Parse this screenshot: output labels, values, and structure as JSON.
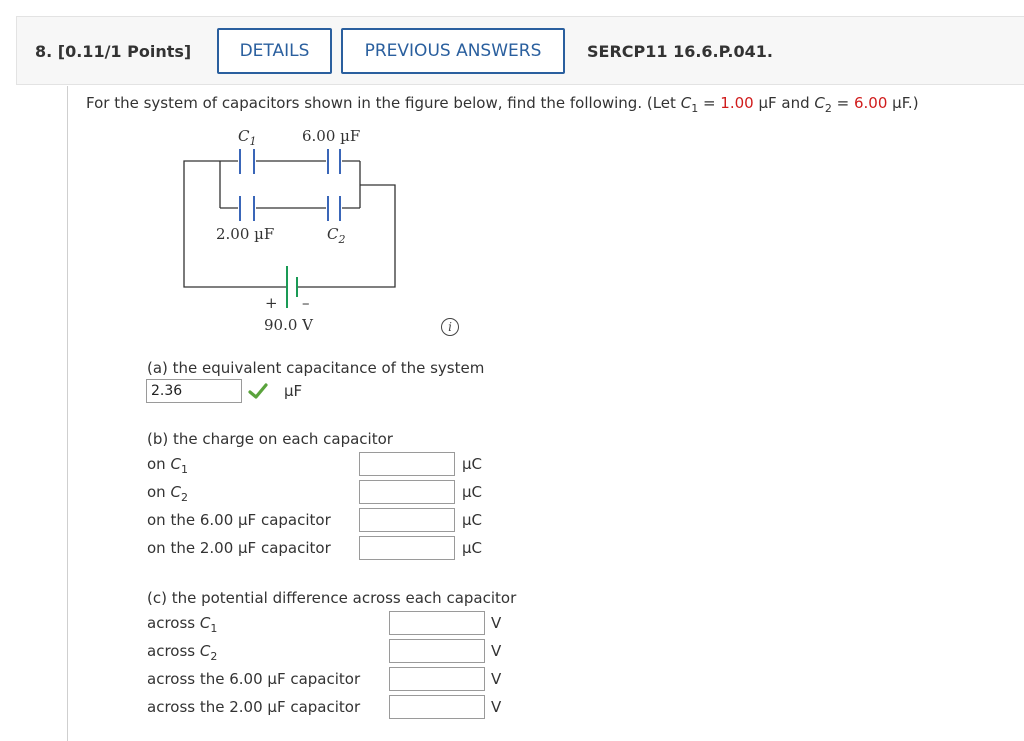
{
  "header": {
    "question_number": "8. [0.11/1 Points]",
    "details_label": "DETAILS",
    "previous_answers_label": "PREVIOUS ANSWERS",
    "problem_code": "SERCP11 16.6.P.041."
  },
  "prompt": {
    "intro": "For the system of capacitors shown in the figure below, find the following. (Let ",
    "c1_symbol": "C",
    "c1_sub": "1",
    "eq1": " = ",
    "c1_value": "1.00",
    "c1_unit_and": " µF and ",
    "c2_symbol": "C",
    "c2_sub": "2",
    "eq2": " = ",
    "c2_value": "6.00",
    "c2_unit_close": " µF.)",
    "highlight_color": "#d01c1c"
  },
  "figure": {
    "label_c1": "C",
    "label_c1_sub": "1",
    "label_6uf": "6.00 µF",
    "label_2uf": "2.00 µF",
    "label_c2": "C",
    "label_c2_sub": "2",
    "plus": "+",
    "minus": "–",
    "battery_voltage": "90.0 V",
    "battery_color": "#1a9a55",
    "capacitor_color": "#3a66b8"
  },
  "part_a": {
    "title": "(a) the equivalent capacitance of the system",
    "value": "2.36",
    "unit": "µF",
    "status": "correct"
  },
  "part_b": {
    "title": "(b) the charge on each capacitor",
    "rows": [
      {
        "prefix": "on ",
        "symbol": "C",
        "sub": "1",
        "unit": "µC",
        "value": ""
      },
      {
        "prefix": "on ",
        "symbol": "C",
        "sub": "2",
        "unit": "µC",
        "value": ""
      },
      {
        "label": "on the 6.00 µF capacitor",
        "unit": "µC",
        "value": ""
      },
      {
        "label": "on the 2.00 µF capacitor",
        "unit": "µC",
        "value": ""
      }
    ]
  },
  "part_c": {
    "title": "(c) the potential difference across each capacitor",
    "rows": [
      {
        "prefix": "across ",
        "symbol": "C",
        "sub": "1",
        "unit": "V",
        "value": ""
      },
      {
        "prefix": "across ",
        "symbol": "C",
        "sub": "2",
        "unit": "V",
        "value": ""
      },
      {
        "label": "across the 6.00 µF capacitor",
        "unit": "V",
        "value": ""
      },
      {
        "label": "across the 2.00 µF capacitor",
        "unit": "V",
        "value": ""
      }
    ]
  }
}
